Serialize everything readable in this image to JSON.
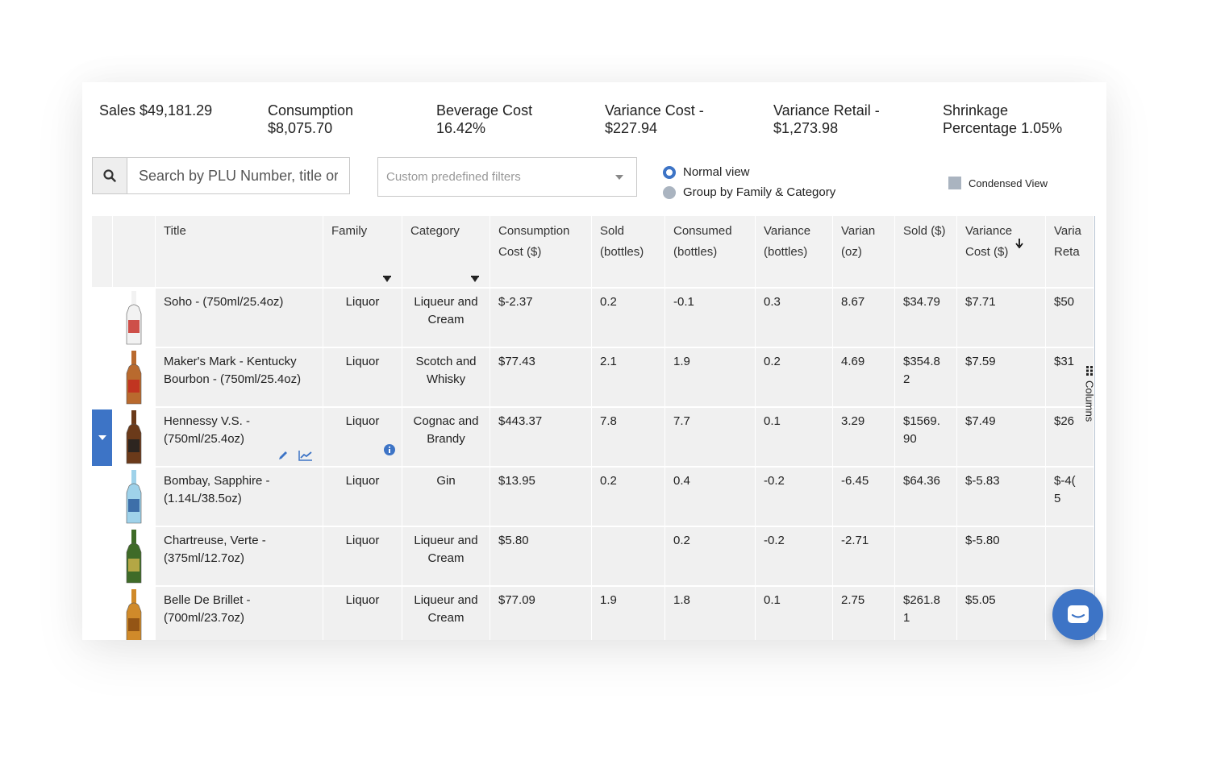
{
  "stats": [
    {
      "label": "Sales $49,181.29"
    },
    {
      "label": "Consumption $8,075.70"
    },
    {
      "label": "Beverage Cost 16.42%"
    },
    {
      "label": "Variance Cost - $227.94"
    },
    {
      "label": "Variance Retail - $1,273.98"
    },
    {
      "label": "Shrinkage Percentage 1.05%"
    }
  ],
  "search": {
    "placeholder": "Search by PLU Number, title or"
  },
  "filter": {
    "placeholder": "Custom predefined filters"
  },
  "view": {
    "normal": "Normal view",
    "group": "Group by Family & Category",
    "condensed": "Condensed View"
  },
  "columns_tab": "Columns",
  "headers": {
    "title": "Title",
    "family": "Family",
    "category": "Category",
    "consumption_cost": "Consumption Cost ($)",
    "sold_bottles": "Sold (bottles)",
    "consumed_bottles": "Consumed (bottles)",
    "variance_bottles": "Variance (bottles)",
    "variance_oz": "Varian (oz)",
    "sold_dollars": "Sold ($)",
    "variance_cost": "Variance Cost ($)",
    "variance_retail": "Varia Reta"
  },
  "rows": [
    {
      "title": "Soho - (750ml/25.4oz)",
      "family": "Liquor",
      "category": "Liqueur and Cream",
      "consumption_cost": "$-2.37",
      "sold": "0.2",
      "consumed": "-0.1",
      "variance": "0.3",
      "variance_oz": "8.67",
      "sold_dollars": "$34.79",
      "variance_cost": "$7.71",
      "variance_retail": "$50"
    },
    {
      "title": "Maker's Mark - Kentucky Bourbon - (750ml/25.4oz)",
      "family": "Liquor",
      "category": "Scotch and Whisky",
      "consumption_cost": "$77.43",
      "sold": "2.1",
      "consumed": "1.9",
      "variance": "0.2",
      "variance_oz": "4.69",
      "sold_dollars": "$354.8 2",
      "variance_cost": "$7.59",
      "variance_retail": "$31"
    },
    {
      "title": "Hennessy V.S. - (750ml/25.4oz)",
      "family": "Liquor",
      "category": "Cognac and Brandy",
      "consumption_cost": "$443.37",
      "sold": "7.8",
      "consumed": "7.7",
      "variance": "0.1",
      "variance_oz": "3.29",
      "sold_dollars": "$1569. 90",
      "variance_cost": "$7.49",
      "variance_retail": "$26"
    },
    {
      "title": "Bombay, Sapphire - (1.14L/38.5oz)",
      "family": "Liquor",
      "category": "Gin",
      "consumption_cost": "$13.95",
      "sold": "0.2",
      "consumed": "0.4",
      "variance": "-0.2",
      "variance_oz": "-6.45",
      "sold_dollars": "$64.36",
      "variance_cost": "$-5.83",
      "variance_retail": "$-4( 5"
    },
    {
      "title": "Chartreuse, Verte - (375ml/12.7oz)",
      "family": "Liquor",
      "category": "Liqueur and Cream",
      "consumption_cost": "$5.80",
      "sold": "",
      "consumed": "0.2",
      "variance": "-0.2",
      "variance_oz": "-2.71",
      "sold_dollars": "",
      "variance_cost": "$-5.80",
      "variance_retail": ""
    },
    {
      "title": "Belle De Brillet - (700ml/23.7oz)",
      "family": "Liquor",
      "category": "Liqueur and Cream",
      "consumption_cost": "$77.09",
      "sold": "1.9",
      "consumed": "1.8",
      "variance": "0.1",
      "variance_oz": "2.75",
      "sold_dollars": "$261.8 1",
      "variance_cost": "$5.05",
      "variance_retail": ""
    }
  ],
  "colors": {
    "accent": "#3d74c6",
    "row_bg": "#f0f0f0",
    "header_bg": "#f2f2f2"
  },
  "icons": [
    "search-icon",
    "chevron-down-icon",
    "pencil-icon",
    "chart-icon",
    "info-icon",
    "columns-icon",
    "chat-icon",
    "sort-down-icon"
  ]
}
